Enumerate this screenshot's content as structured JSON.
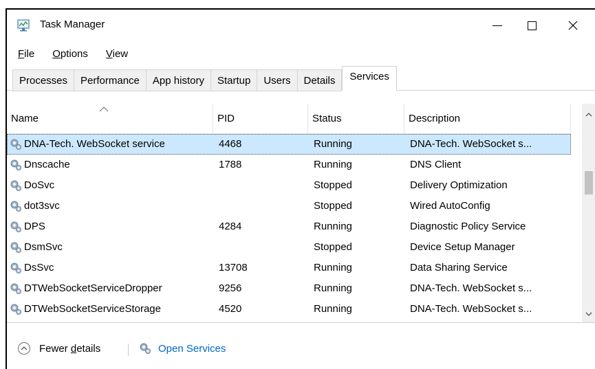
{
  "window": {
    "title": "Task Manager",
    "controls": {
      "minimize": "—",
      "maximize": "☐",
      "close": "✕"
    }
  },
  "menu": {
    "items": [
      {
        "label": "File",
        "underline": "F",
        "rest": "ile"
      },
      {
        "label": "Options",
        "underline": "O",
        "rest": "ptions"
      },
      {
        "label": "View",
        "underline": "V",
        "rest": "iew"
      }
    ]
  },
  "tabs": [
    {
      "label": "Processes",
      "active": false
    },
    {
      "label": "Performance",
      "active": false
    },
    {
      "label": "App history",
      "active": false
    },
    {
      "label": "Startup",
      "active": false
    },
    {
      "label": "Users",
      "active": false
    },
    {
      "label": "Details",
      "active": false
    },
    {
      "label": "Services",
      "active": true
    }
  ],
  "table": {
    "columns": [
      "Name",
      "PID",
      "Status",
      "Description"
    ],
    "sort_indicator": "^",
    "rows": [
      {
        "name": "DNA-Tech. WebSocket service",
        "pid": "4468",
        "status": "Running",
        "description": "DNA-Tech. WebSocket s...",
        "selected": true
      },
      {
        "name": "Dnscache",
        "pid": "1788",
        "status": "Running",
        "description": "DNS Client",
        "selected": false
      },
      {
        "name": "DoSvc",
        "pid": "",
        "status": "Stopped",
        "description": "Delivery Optimization",
        "selected": false
      },
      {
        "name": "dot3svc",
        "pid": "",
        "status": "Stopped",
        "description": "Wired AutoConfig",
        "selected": false
      },
      {
        "name": "DPS",
        "pid": "4284",
        "status": "Running",
        "description": "Diagnostic Policy Service",
        "selected": false
      },
      {
        "name": "DsmSvc",
        "pid": "",
        "status": "Stopped",
        "description": "Device Setup Manager",
        "selected": false
      },
      {
        "name": "DsSvc",
        "pid": "13708",
        "status": "Running",
        "description": "Data Sharing Service",
        "selected": false
      },
      {
        "name": "DTWebSocketServiceDropper",
        "pid": "9256",
        "status": "Running",
        "description": "DNA-Tech. WebSocket s...",
        "selected": false
      },
      {
        "name": "DTWebSocketServiceStorage",
        "pid": "4520",
        "status": "Running",
        "description": "DNA-Tech. WebSocket s...",
        "selected": false
      }
    ]
  },
  "footer": {
    "fewer_details_prefix": "Fewer ",
    "fewer_details_underline": "d",
    "fewer_details_rest": "etails",
    "open_services": "Open Services"
  },
  "colors": {
    "selected_row": "#cce8ff",
    "link": "#0066cc",
    "gear_icon": "#8aa3b8"
  }
}
